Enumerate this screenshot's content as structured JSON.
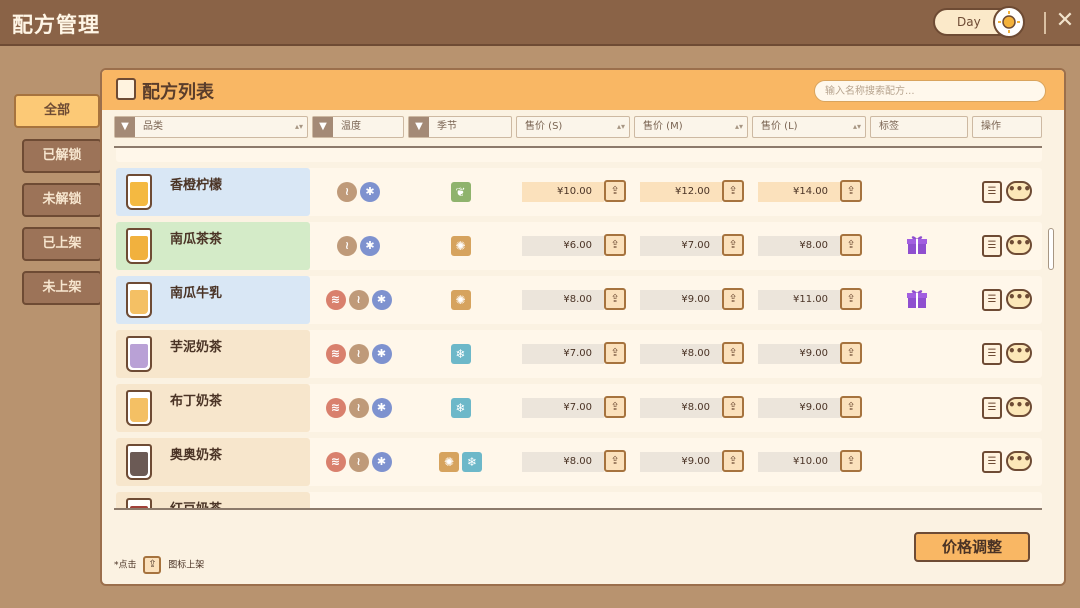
{
  "app": {
    "title": "配方管理",
    "mode": "Day",
    "close": "✕"
  },
  "filters": [
    "全部",
    "已解锁",
    "未解锁",
    "已上架",
    "未上架"
  ],
  "panel": {
    "title": "配方列表",
    "search_placeholder": "输入名称搜索配方...",
    "columns": [
      "品类",
      "温度",
      "季节",
      "售价 (S)",
      "售价 (M)",
      "售价 (L)",
      "标签",
      "操作"
    ],
    "adjust_button": "价格调整",
    "hint_prefix": "*点击",
    "hint_suffix": "图标上架"
  },
  "icons": {
    "filter": "filter-icon",
    "shelf": "upload-icon",
    "more": "more-icon",
    "recipe": "recipe-book-icon",
    "gift": "gift-icon"
  },
  "colors": {
    "accent": "#f9b764",
    "brown": "#6e4b34",
    "gift": "#8f4fcf"
  },
  "rows": [
    {
      "name": "香橙柠檬",
      "bg": "#d9e7f5",
      "cup": "#f4b941",
      "temps": [
        "warm",
        "cold"
      ],
      "seasons": [
        "spring"
      ],
      "prices": [
        "¥10.00",
        "¥12.00",
        "¥14.00"
      ],
      "on": true,
      "gift": false
    },
    {
      "name": "南瓜茶茶",
      "bg": "#d4ebc8",
      "cup": "#f1b13e",
      "temps": [
        "warm",
        "cold"
      ],
      "seasons": [
        "autumn"
      ],
      "prices": [
        "¥6.00",
        "¥7.00",
        "¥8.00"
      ],
      "on": false,
      "gift": true
    },
    {
      "name": "南瓜牛乳",
      "bg": "#d9e7f5",
      "cup": "#f4c064",
      "temps": [
        "hot",
        "warm",
        "cold"
      ],
      "seasons": [
        "autumn"
      ],
      "prices": [
        "¥8.00",
        "¥9.00",
        "¥11.00"
      ],
      "on": false,
      "gift": true
    },
    {
      "name": "芋泥奶茶",
      "bg": "#f7e6cc",
      "cup": "#b9a1d6",
      "temps": [
        "hot",
        "warm",
        "cold"
      ],
      "seasons": [
        "winter"
      ],
      "prices": [
        "¥7.00",
        "¥8.00",
        "¥9.00"
      ],
      "on": false,
      "gift": false
    },
    {
      "name": "布丁奶茶",
      "bg": "#f7e6cc",
      "cup": "#f4c064",
      "temps": [
        "hot",
        "warm",
        "cold"
      ],
      "seasons": [
        "winter"
      ],
      "prices": [
        "¥7.00",
        "¥8.00",
        "¥9.00"
      ],
      "on": false,
      "gift": false
    },
    {
      "name": "奥奥奶茶",
      "bg": "#f7e6cc",
      "cup": "#6b5a55",
      "temps": [
        "hot",
        "warm",
        "cold"
      ],
      "seasons": [
        "autumn",
        "winter"
      ],
      "prices": [
        "¥8.00",
        "¥9.00",
        "¥10.00"
      ],
      "on": false,
      "gift": false
    },
    {
      "name": "红豆奶茶",
      "bg": "#f7e6cc",
      "cup": "#a0413a",
      "temps": [],
      "seasons": [],
      "prices": [
        "",
        "",
        ""
      ],
      "on": false,
      "gift": false
    }
  ]
}
